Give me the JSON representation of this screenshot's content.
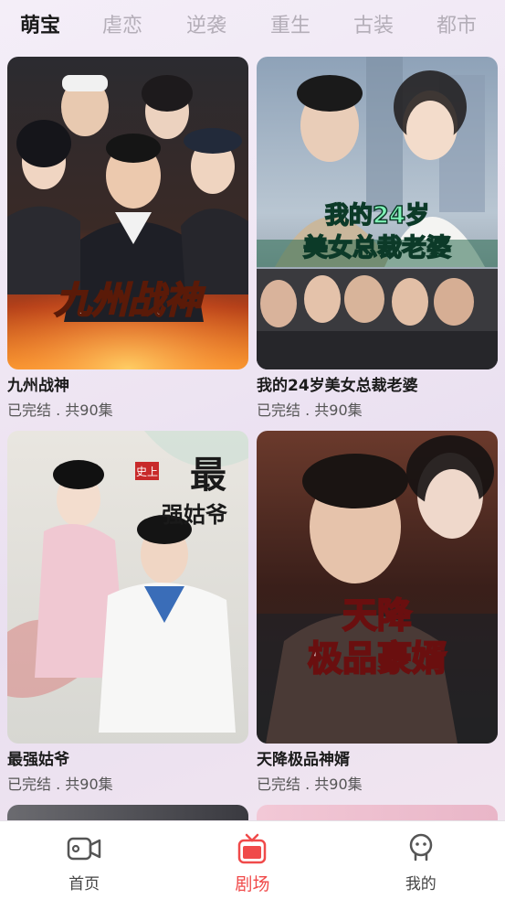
{
  "tabs": [
    {
      "label": "萌宝",
      "active": true
    },
    {
      "label": "虐恋",
      "active": false
    },
    {
      "label": "逆袭",
      "active": false
    },
    {
      "label": "重生",
      "active": false
    },
    {
      "label": "古装",
      "active": false
    },
    {
      "label": "都市",
      "active": false
    }
  ],
  "cards": [
    {
      "title": "九州战神",
      "status": "已完结 . 共90集",
      "poster_text": "九州战神"
    },
    {
      "title": "我的24岁美女总裁老婆",
      "status": "已完结 . 共90集",
      "poster_text_1": "我的24岁",
      "poster_text_2": "美女总裁老婆"
    },
    {
      "title": "最强姑爷",
      "status": "已完结 . 共90集",
      "poster_text_1": "最",
      "poster_text_2": "强姑爷",
      "poster_badge": "史上"
    },
    {
      "title": "天降极品神婿",
      "status": "已完结 . 共90集",
      "poster_text_1": "天降",
      "poster_text_2": "极品豪婿"
    }
  ],
  "nav": [
    {
      "label": "首页",
      "icon": "video-camera-icon",
      "active": false
    },
    {
      "label": "剧场",
      "icon": "tv-icon",
      "active": true
    },
    {
      "label": "我的",
      "icon": "person-icon",
      "active": false
    }
  ],
  "colors": {
    "accent": "#f04a4a",
    "inactive_tab": "#b4aeb8"
  }
}
